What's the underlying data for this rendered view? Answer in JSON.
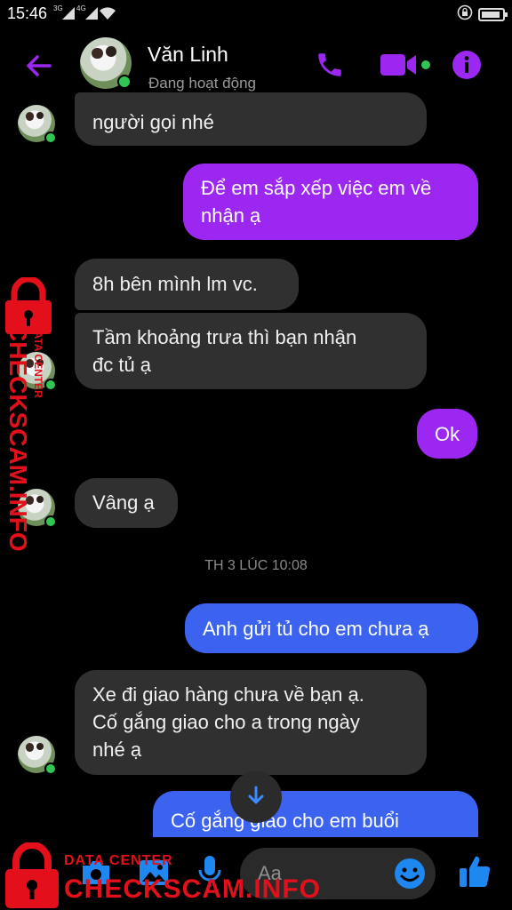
{
  "status_bar": {
    "time": "15:46",
    "net1": "3G",
    "net2": "4G"
  },
  "header": {
    "name": "Văn Linh",
    "status": "Đang hoạt động",
    "accent_color": "#9b27f0",
    "online_color": "#31c553"
  },
  "messages": [
    {
      "side": "in",
      "text": "người gọi nhé"
    },
    {
      "side": "out",
      "color": "purple",
      "text": "Để em sắp xếp việc em về\nnhận ạ"
    },
    {
      "side": "in",
      "text": "8h bên mình lm vc."
    },
    {
      "side": "in",
      "text": "Tầm khoảng trưa thì bạn nhận\nđc tủ ạ"
    },
    {
      "side": "out",
      "color": "purple",
      "text": "Ok"
    },
    {
      "side": "in",
      "text": "Vâng ạ"
    },
    {
      "side": "out",
      "color": "blue",
      "text": "Anh gửi tủ cho em chưa ạ"
    },
    {
      "side": "in",
      "text": "Xe đi giao hàng chưa về bạn ạ.\nCố gắng giao cho a trong ngày\nnhé ạ"
    },
    {
      "side": "out",
      "color": "blue",
      "text": "Cố gắng  giao cho em buổi"
    }
  ],
  "timestamp": "TH 3 LÚC 10:08",
  "composer": {
    "placeholder": "Aa"
  },
  "icons": {
    "back": "arrow-left-icon",
    "call": "phone-icon",
    "video": "video-camera-icon",
    "info": "info-icon",
    "scroll": "arrow-down-icon",
    "camera": "camera-icon",
    "gallery": "image-icon",
    "mic": "microphone-icon",
    "emoji": "emoji-icon",
    "like": "thumbs-up-icon"
  },
  "watermark": {
    "line1": "DATA CENTER",
    "line2": "CHECKSCAM.INFO"
  }
}
